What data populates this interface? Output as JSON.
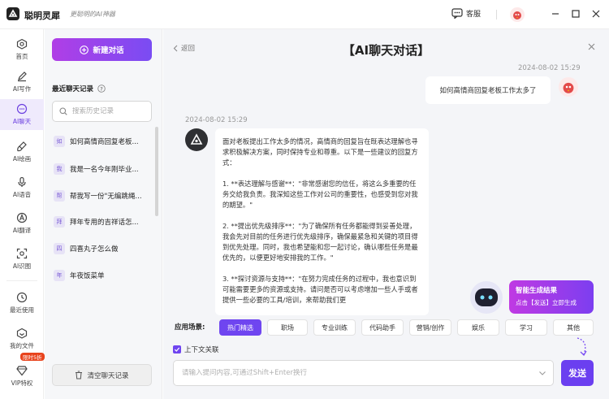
{
  "app": {
    "name": "聪明灵犀",
    "slogan": "更聪明的AI神器",
    "service_label": "客服"
  },
  "nav": {
    "items": [
      {
        "label": "首页",
        "icon": "home-icon"
      },
      {
        "label": "AI写作",
        "icon": "pen-icon"
      },
      {
        "label": "AI聊天",
        "icon": "chat-icon",
        "active": true
      },
      {
        "label": "AI绘画",
        "icon": "brush-icon"
      },
      {
        "label": "AI语音",
        "icon": "microphone-icon"
      },
      {
        "label": "AI翻译",
        "icon": "translate-icon"
      },
      {
        "label": "AI识图",
        "icon": "image-recognition-icon"
      }
    ],
    "bottom": [
      {
        "label": "最近使用",
        "icon": "clock-icon"
      },
      {
        "label": "我的文件",
        "icon": "folder-icon"
      },
      {
        "label": "VIP特权",
        "icon": "diamond-icon"
      }
    ],
    "vip_badge": "限时5折"
  },
  "history": {
    "new_chat_label": "新建对话",
    "title": "最近聊天记录",
    "search_placeholder": "搜索历史记录",
    "items": [
      {
        "badge": "如",
        "text": "如何高情商回复老板..."
      },
      {
        "badge": "我",
        "text": "我是一名今年刚毕业..."
      },
      {
        "badge": "帮",
        "text": "帮我写一份\"无编跳绳..."
      },
      {
        "badge": "拜",
        "text": "拜年专用的吉祥话怎..."
      },
      {
        "badge": "四",
        "text": "四喜丸子怎么做"
      },
      {
        "badge": "年",
        "text": "年夜饭菜单"
      }
    ],
    "clear_label": "清空聊天记录"
  },
  "chat": {
    "back_label": "返回",
    "title": "【AI聊天对话】",
    "user_time": "2024-08-02 15:29",
    "user_message": "如何高情商回复老板工作太多了",
    "bot_time": "2024-08-02 15:29",
    "bot_paragraphs": [
      "面对老板提出工作太多的情况，高情商的回复旨在既表达理解也寻求积极解决方案，同时保持专业和尊重。以下是一些建议的回复方式：",
      "1. **表达理解与感谢**：\"非常感谢您的信任，将这么多重要的任务交给我负责。我深知这些工作对公司的重要性，也感受到您对我的期望。\"",
      "2. **提出优先级排序**：\"为了确保所有任务都能得到妥善处理，我会先对目前的任务进行优先级排序，确保最紧急和关键的项目得到优先处理。同时，我也希望能和您一起讨论，确认哪些任务是最优先的，以便更好地安排我的工作。\"",
      "3. **探讨资源与支持**：\"在努力完成任务的过程中，我也意识到可能需要更多的资源或支持。请问是否可以考虑增加一些人手或者提供一些必要的工具/培训，来帮助我们更"
    ]
  },
  "promo": {
    "title": "智能生成结果",
    "subtitle": "点击【发送】立即生成"
  },
  "scenes": {
    "label": "应用场景:",
    "chips": [
      "热门精选",
      "职场",
      "专业训练",
      "代码助手",
      "营销/创作",
      "娱乐",
      "学习",
      "其他"
    ]
  },
  "composer": {
    "context_label": "上下文关联",
    "placeholder": "请输入提问内容,可通过Shift+Enter换行",
    "send_label": "发送"
  },
  "colors": {
    "accent": "#6f45f0",
    "gradient_start": "#b03ee6",
    "gradient_end": "#7a4cf3"
  }
}
